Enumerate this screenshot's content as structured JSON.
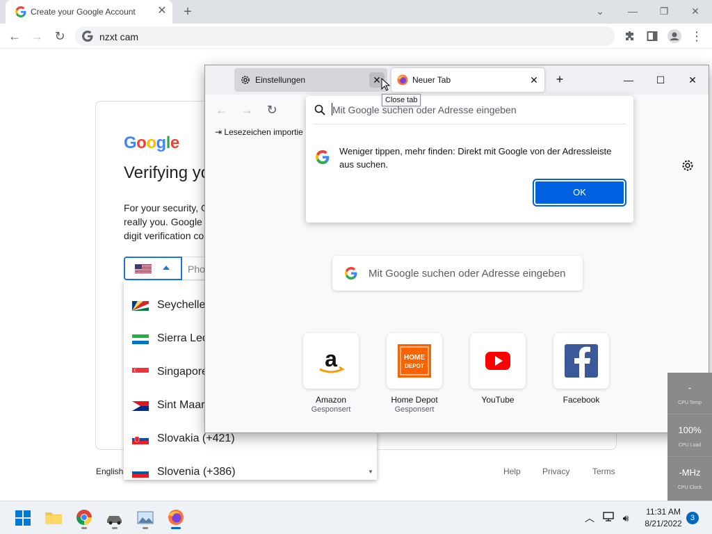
{
  "chrome": {
    "tab_title": "Create your Google Account",
    "url": "nzxt cam",
    "google_logo": "Google",
    "heading": "Verifying yo",
    "paragraph_lines": [
      "For your security, G",
      "really you. Google w",
      "digit verification co"
    ],
    "phone_placeholder": "Pho",
    "country_list": [
      {
        "name": "Seychelle",
        "flag": "seychelles-flag"
      },
      {
        "name": "Sierra Leo",
        "flag": "sierra-leone-flag"
      },
      {
        "name": "Singapore",
        "flag": "singapore-flag"
      },
      {
        "name": "Sint Maar",
        "flag": "sint-maarten-flag"
      },
      {
        "name": "Slovakia (+421)",
        "flag": "slovakia-flag"
      },
      {
        "name": "Slovenia (+386)",
        "flag": "slovenia-flag"
      }
    ],
    "footer": {
      "language": "English",
      "help": "Help",
      "privacy": "Privacy",
      "terms": "Terms"
    }
  },
  "firefox": {
    "tabs": [
      {
        "label": "Einstellungen"
      },
      {
        "label": "Neuer Tab"
      }
    ],
    "tooltip": "Close tab",
    "bookmarks_import": "Lesezeichen importie",
    "urlbar_placeholder": "Mit Google suchen oder Adresse eingeben",
    "popup_message": "Weniger tippen, mehr finden: Direkt mit Google von der Adressleiste aus suchen.",
    "ok_label": "OK",
    "search_placeholder": "Mit Google suchen oder Adresse eingeben",
    "tiles": [
      {
        "label": "Amazon",
        "sponsored": "Gesponsert"
      },
      {
        "label": "Home Depot",
        "sponsored": "Gesponsert"
      },
      {
        "label": "YouTube",
        "sponsored": ""
      },
      {
        "label": "Facebook",
        "sponsored": ""
      }
    ]
  },
  "cpu_widget": [
    {
      "value": "-",
      "label": "CPU Temp"
    },
    {
      "value": "100%",
      "label": "CPU Load"
    },
    {
      "value": "-MHz",
      "label": "CPU Clock"
    }
  ],
  "taskbar": {
    "time": "11:31 AM",
    "date": "8/21/2022",
    "notifications": "3"
  },
  "colors": {
    "google_blue": "#4285f4",
    "google_red": "#ea4335",
    "google_yellow": "#fbbc05",
    "google_green": "#34a853",
    "firefox_ok_button": "#0061e0"
  }
}
